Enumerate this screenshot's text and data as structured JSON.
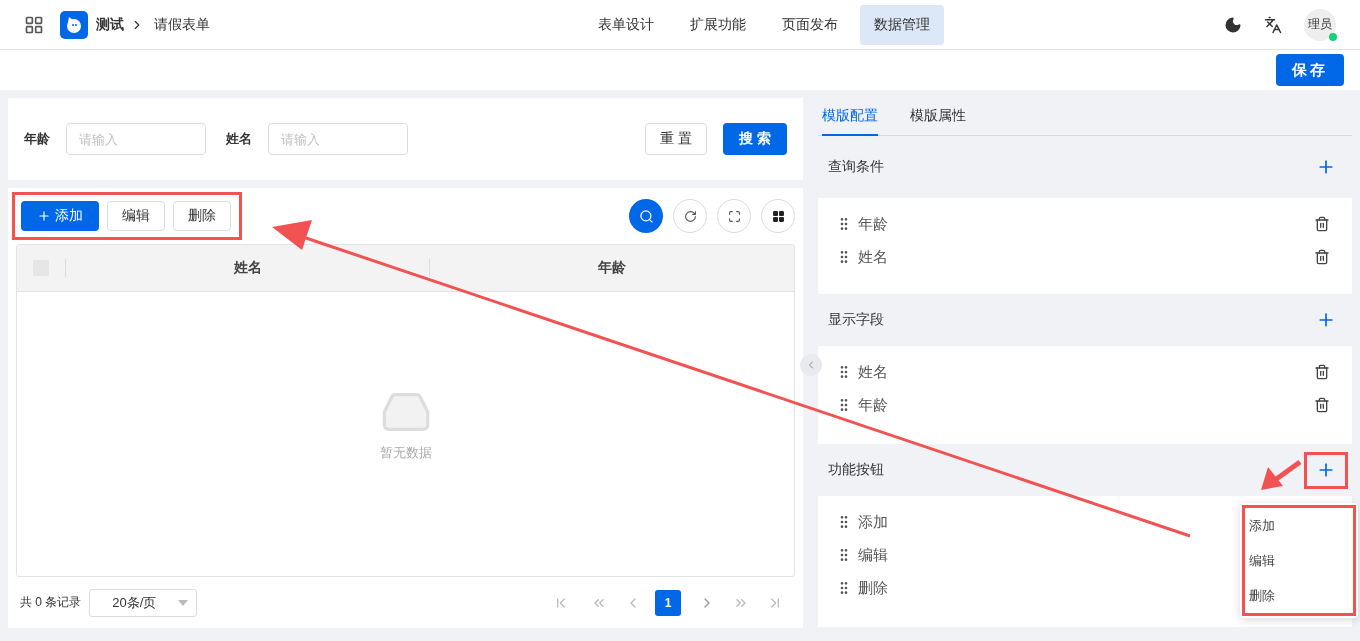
{
  "header": {
    "app_name": "测试",
    "breadcrumb": "请假表单",
    "nav": [
      {
        "label": "表单设计",
        "selected": false
      },
      {
        "label": "扩展功能",
        "selected": false
      },
      {
        "label": "页面发布",
        "selected": false
      },
      {
        "label": "数据管理",
        "selected": true
      }
    ],
    "avatar": "理员",
    "online": true
  },
  "save_button": "保存",
  "search": {
    "fields": [
      {
        "label": "年龄",
        "placeholder": "请输入"
      },
      {
        "label": "姓名",
        "placeholder": "请输入"
      }
    ],
    "reset": "重 置",
    "submit": "搜 索"
  },
  "table": {
    "highlighted": true,
    "actions": [
      {
        "label": "添加",
        "primary": true
      },
      {
        "label": "编辑",
        "primary": false
      },
      {
        "label": "删除",
        "primary": false
      }
    ],
    "select_all_checked": false,
    "columns": [
      "姓名",
      "年龄"
    ],
    "empty_text": "暂无数据",
    "total": "共 0 条记录",
    "page_size": "20条/页",
    "pages": [
      {
        "label": "1",
        "selected": true
      }
    ]
  },
  "panel": {
    "tabs": [
      {
        "label": "模版配置",
        "selected": true
      },
      {
        "label": "模版属性",
        "selected": false
      }
    ],
    "sections": [
      {
        "title": "查询条件",
        "highlighted": false,
        "items": [
          {
            "label": "年龄",
            "deletable": true
          },
          {
            "label": "姓名",
            "deletable": true
          }
        ]
      },
      {
        "title": "显示字段",
        "highlighted": false,
        "items": [
          {
            "label": "姓名",
            "deletable": true
          },
          {
            "label": "年龄",
            "deletable": true
          }
        ]
      },
      {
        "title": "功能按钮",
        "highlighted": true,
        "items": [
          {
            "label": "添加",
            "deletable": false
          },
          {
            "label": "编辑",
            "deletable": false
          },
          {
            "label": "删除",
            "deletable": false
          }
        ]
      }
    ],
    "menu": {
      "highlighted": true,
      "items": [
        "添加",
        "编辑",
        "删除"
      ]
    }
  }
}
